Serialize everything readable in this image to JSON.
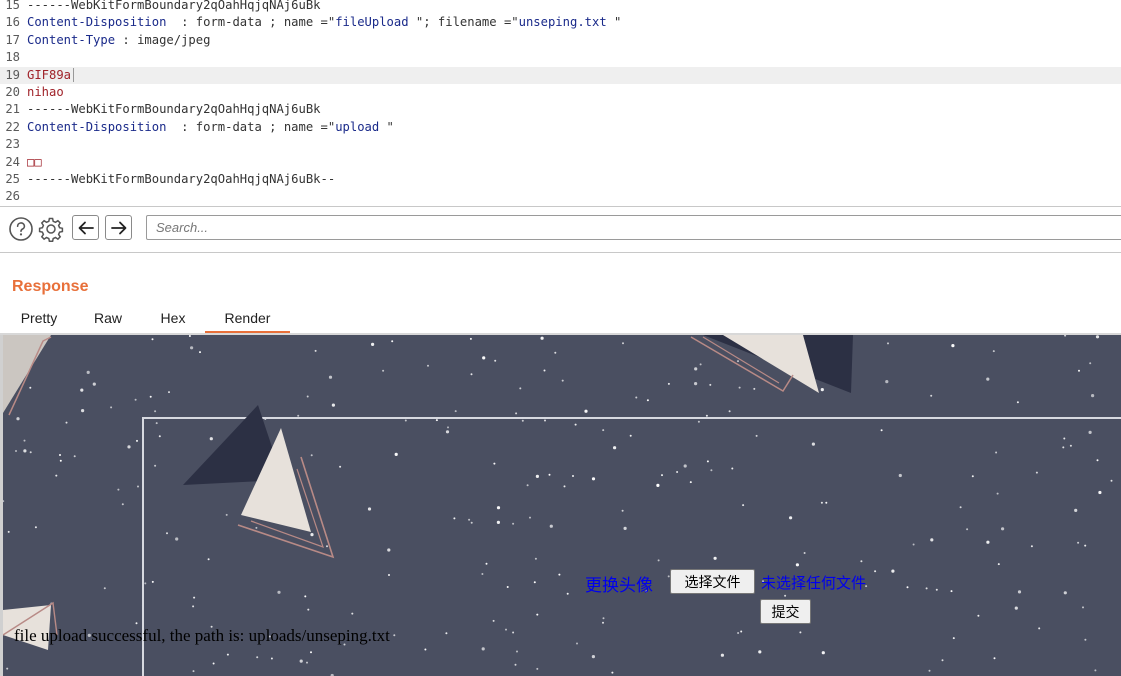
{
  "editor": {
    "lines": [
      {
        "num": "15",
        "segments": [
          {
            "t": "------WebKitFormBoundary2qOahHqjqNAj6uBk",
            "c": "plain"
          }
        ]
      },
      {
        "num": "16",
        "segments": [
          {
            "t": "Content-Disposition",
            "c": "header"
          },
          {
            "t": "  : form-data ; name =\"",
            "c": "plain"
          },
          {
            "t": "fileUpload",
            "c": "str"
          },
          {
            "t": " \"; filename =\"",
            "c": "plain"
          },
          {
            "t": "unseping.txt",
            "c": "str"
          },
          {
            "t": " \"",
            "c": "plain"
          }
        ]
      },
      {
        "num": "17",
        "segments": [
          {
            "t": "Content-Type",
            "c": "header"
          },
          {
            "t": " : image/jpeg",
            "c": "plain"
          }
        ]
      },
      {
        "num": "18",
        "segments": []
      },
      {
        "num": "19",
        "segments": [
          {
            "t": "GIF89a",
            "c": "red"
          }
        ],
        "highlight": true,
        "cursor": true
      },
      {
        "num": "20",
        "segments": [
          {
            "t": "nihao",
            "c": "red"
          }
        ]
      },
      {
        "num": "21",
        "segments": [
          {
            "t": "------WebKitFormBoundary2qOahHqjqNAj6uBk",
            "c": "plain"
          }
        ]
      },
      {
        "num": "22",
        "segments": [
          {
            "t": "Content-Disposition",
            "c": "header"
          },
          {
            "t": "  : form-data ; name =\"",
            "c": "plain"
          },
          {
            "t": "upload",
            "c": "str"
          },
          {
            "t": " \"",
            "c": "plain"
          }
        ]
      },
      {
        "num": "23",
        "segments": []
      },
      {
        "num": "24",
        "segments": [
          {
            "t": "□□",
            "c": "red"
          }
        ]
      },
      {
        "num": "25",
        "segments": [
          {
            "t": "------WebKitFormBoundary2qOahHqjqNAj6uBk--",
            "c": "plain"
          }
        ]
      },
      {
        "num": "26",
        "segments": []
      }
    ]
  },
  "toolbar": {
    "help_icon": "help-icon",
    "settings_icon": "gear-icon",
    "back_icon": "arrow-left-icon",
    "forward_icon": "arrow-right-icon",
    "search_placeholder": "Search..."
  },
  "response": {
    "title": "Response",
    "tabs": [
      {
        "label": "Pretty",
        "active": false
      },
      {
        "label": "Raw",
        "active": false
      },
      {
        "label": "Hex",
        "active": false
      },
      {
        "label": "Render",
        "active": true
      }
    ]
  },
  "render": {
    "avatar_label": "更换头像",
    "choose_file_label": "选择文件",
    "no_file_label": "未选择任何文件",
    "submit_label": "提交",
    "result": "file upload successful, the path is: uploads/unseping.txt"
  },
  "colors": {
    "accent": "#e8703a",
    "render_bg": "#4a4f61",
    "link_blue": "#0000ee"
  }
}
